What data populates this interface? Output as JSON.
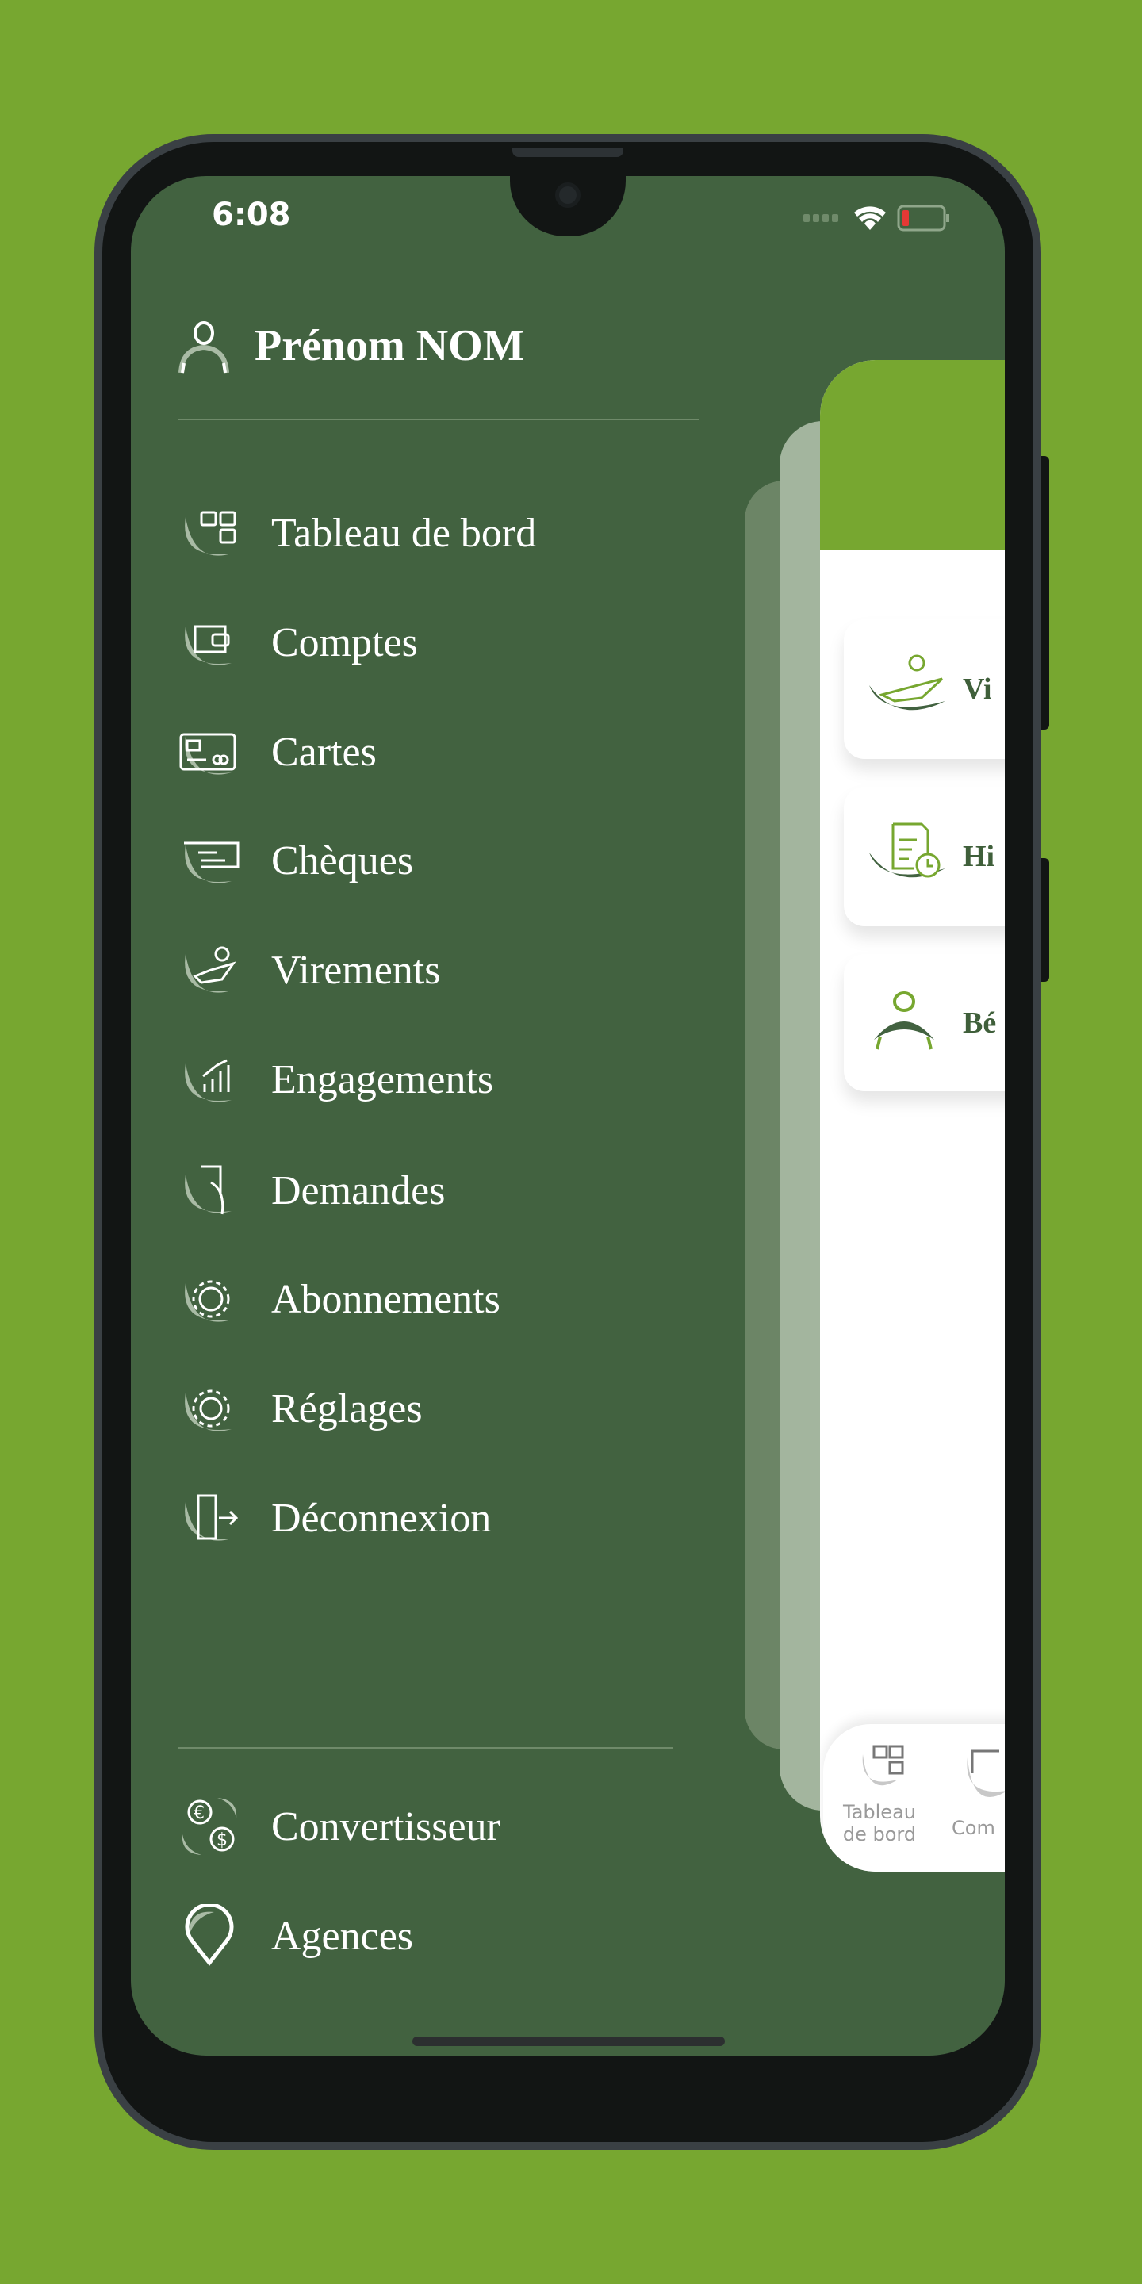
{
  "status_bar": {
    "time": "6:08",
    "battery_level": "low",
    "wifi_icon": "wifi-icon",
    "battery_color": "#e53935"
  },
  "colors": {
    "background": "#77a730",
    "drawer": "#426240",
    "accent": "#77a730",
    "dark_green": "#3f5f3a"
  },
  "profile": {
    "name": "Prénom NOM",
    "icon": "user-icon"
  },
  "menu": {
    "items": [
      {
        "label": "Tableau de bord",
        "icon": "dashboard-icon"
      },
      {
        "label": "Comptes",
        "icon": "wallet-icon"
      },
      {
        "label": "Cartes",
        "icon": "card-icon"
      },
      {
        "label": "Chèques",
        "icon": "cheque-icon"
      },
      {
        "label": "Virements",
        "icon": "transfer-icon"
      },
      {
        "label": "Engagements",
        "icon": "chart-icon"
      },
      {
        "label": "Demandes",
        "icon": "request-icon"
      },
      {
        "label": "Abonnements",
        "icon": "gear-icon"
      },
      {
        "label": "Réglages",
        "icon": "settings-icon"
      },
      {
        "label": "Déconnexion",
        "icon": "logout-icon"
      }
    ],
    "footer": [
      {
        "label": "Convertisseur",
        "icon": "currency-icon"
      },
      {
        "label": "Agences",
        "icon": "location-icon"
      }
    ]
  },
  "main": {
    "cards": [
      {
        "label": "Vi"
      },
      {
        "label": "Hi"
      },
      {
        "label": "Bé"
      }
    ],
    "bottom_nav": [
      {
        "label_line1": "Tableau",
        "label_line2": "de bord"
      },
      {
        "label_line1": "Com"
      }
    ]
  }
}
